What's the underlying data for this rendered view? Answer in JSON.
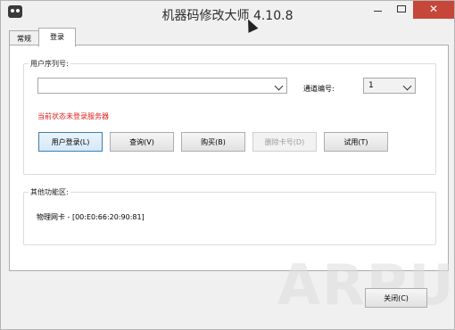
{
  "window": {
    "title": "机器码修改大师 4.10.8",
    "close_glyph": "✕"
  },
  "tabs": [
    {
      "label": "常规"
    },
    {
      "label": "登录"
    }
  ],
  "login": {
    "group_title": "用户序列号:",
    "serial_input_value": "",
    "channel_label": "通道编号:",
    "channel_value": "1",
    "status_text": "当前状态未登录服务器",
    "status_color": "#e01f1f",
    "buttons": [
      {
        "label": "用户登录(L)",
        "state": "focused"
      },
      {
        "label": "查询(V)",
        "state": "normal"
      },
      {
        "label": "购买(B)",
        "state": "normal"
      },
      {
        "label": "删除卡号(D)",
        "state": "disabled"
      },
      {
        "label": "试用(T)",
        "state": "normal"
      }
    ]
  },
  "other": {
    "group_title": "其他功能区:",
    "mac_text": "物理网卡 - [00:E0:66:20:90:81]"
  },
  "footer": {
    "close_label": "关闭(C)"
  },
  "watermark": "ARPUN"
}
